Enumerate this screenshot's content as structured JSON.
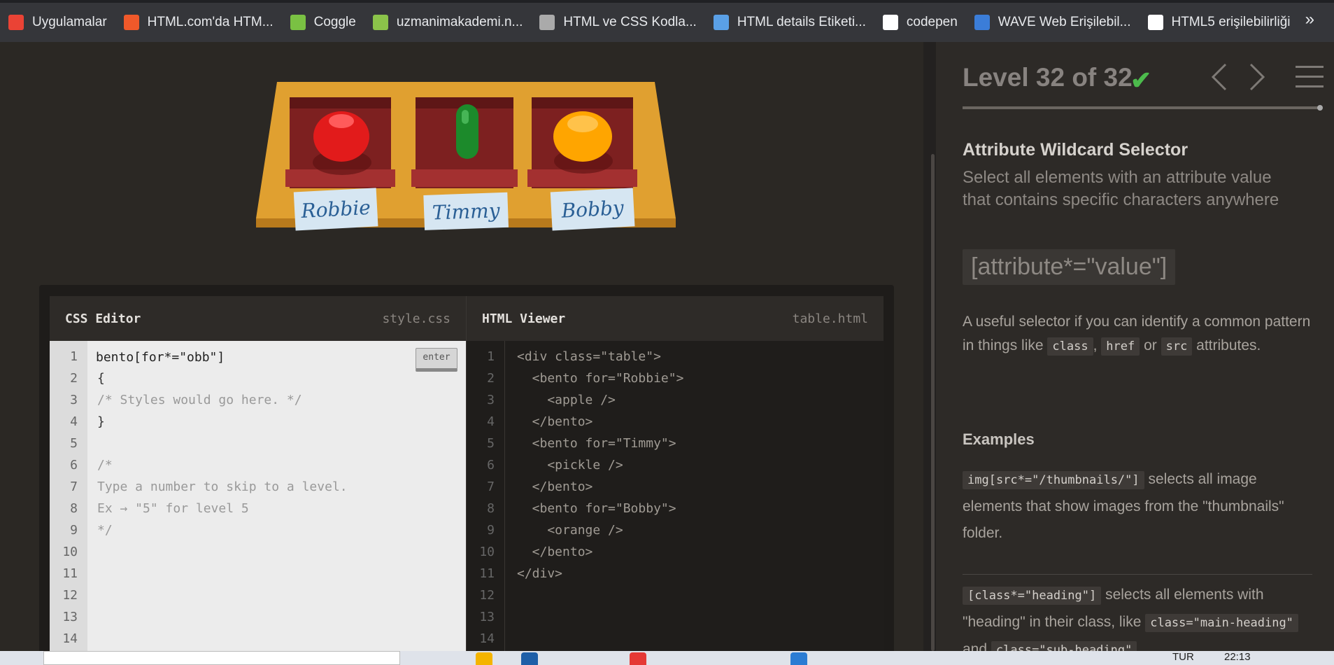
{
  "bookmarks": [
    {
      "label": "Uygulamalar",
      "icon": "apps-grid-icon",
      "color": "#ea4335"
    },
    {
      "label": "HTML.com'da HTM...",
      "icon": "htmlcom-icon",
      "color": "#f0592a"
    },
    {
      "label": "Coggle",
      "icon": "coggle-icon",
      "color": "#7ac143"
    },
    {
      "label": "uzmanimakademi.n...",
      "icon": "leaf-icon",
      "color": "#8bc34a"
    },
    {
      "label": "HTML ve CSS Kodla...",
      "icon": "code-brackets-icon",
      "color": "#aaaaaa"
    },
    {
      "label": "HTML details Etiketi...",
      "icon": "drop-icon",
      "color": "#5aa0e6"
    },
    {
      "label": "codepen",
      "icon": "codepen-icon",
      "color": "#ffffff"
    },
    {
      "label": "WAVE Web Erişilebil...",
      "icon": "wave-icon",
      "color": "#3b7dd8"
    },
    {
      "label": "HTML5 erişilebilirliği",
      "icon": "globe-icon",
      "color": "#ffffff"
    }
  ],
  "bookmarks_more": "»",
  "table": {
    "names": [
      "Robbie",
      "Timmy",
      "Bobby"
    ],
    "items": [
      "apple",
      "pickle",
      "orange"
    ]
  },
  "css_editor": {
    "title": "CSS Editor",
    "file": "style.css",
    "input_value": "bento[for*=\"obb\"]",
    "enter_label": "enter",
    "lines": [
      "",
      "{",
      "/* Styles would go here. */",
      "}",
      "",
      "/*",
      "Type a number to skip to a level.",
      "Ex → \"5\" for level 5",
      "*/",
      "",
      "",
      "",
      "",
      ""
    ],
    "line_numbers": [
      "1",
      "2",
      "3",
      "4",
      "5",
      "6",
      "7",
      "8",
      "9",
      "10",
      "11",
      "12",
      "13",
      "14"
    ]
  },
  "html_viewer": {
    "title": "HTML Viewer",
    "file": "table.html",
    "lines": [
      "<div class=\"table\">",
      "  <bento for=\"Robbie\">",
      "    <apple />",
      "  </bento>",
      "  <bento for=\"Timmy\">",
      "    <pickle />",
      "  </bento>",
      "  <bento for=\"Bobby\">",
      "    <orange />",
      "  </bento>",
      "</div>",
      "",
      "",
      ""
    ]
  },
  "sidebar": {
    "level_label": "Level 32 of 32",
    "check": "✔",
    "progress": 1.0,
    "selector_name": "Attribute Wildcard Selector",
    "selector_desc": "Select all elements with an attribute value that contains specific characters anywhere",
    "syntax": "[attribute*=\"value\"]",
    "hint_pre": "A useful selector if you can identify a common pattern in things like",
    "hint_codes": [
      "class",
      "href",
      "src"
    ],
    "hint_sep1": ",",
    "hint_sep2": "or",
    "hint_post": "attributes.",
    "examples_title": "Examples",
    "example1_code": "img[src*=\"/thumbnails/\"]",
    "example1_text": "selects all image elements that show images from the \"thumbnails\" folder.",
    "example2_code": "[class*=\"heading\"]",
    "example2_text1": "selects all elements with \"heading\" in their class, like",
    "example2_code2": "class=\"main-heading\"",
    "example2_and": "and",
    "example2_code3": "class=\"sub-heading\""
  },
  "taskbar": {
    "lang": "TUR",
    "time": "22:13"
  }
}
